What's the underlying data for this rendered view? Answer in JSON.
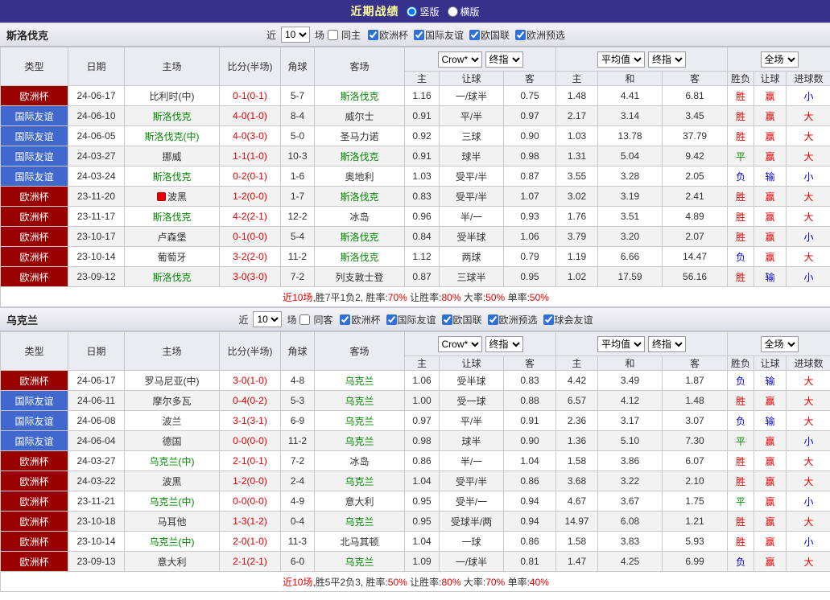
{
  "top_bar": {
    "title": "近期战绩",
    "layout_options": [
      {
        "label": "竖版",
        "selected": true
      },
      {
        "label": "横版",
        "selected": false
      }
    ]
  },
  "colors": {
    "win": "#e60000",
    "draw": "#008800",
    "loss": "#0000dd",
    "euro_bg": "#990000",
    "friendly_bg": "#4169cd",
    "team_highlight": "#008800",
    "score": "#e60000",
    "topbar_bg": "#37318c",
    "title": "#ffff99"
  },
  "table_columns": {
    "static": [
      "类型",
      "日期",
      "主场",
      "比分(半场)",
      "角球",
      "客场"
    ],
    "group1": {
      "selects": [
        "Crow*",
        "终指"
      ],
      "sub": [
        "主",
        "让球",
        "客"
      ]
    },
    "group2": {
      "selects": [
        "平均值",
        "终指"
      ],
      "sub": [
        "主",
        "和",
        "客"
      ]
    },
    "group3": {
      "selects": [
        "全场"
      ],
      "sub": [
        "胜负",
        "让球",
        "进球数"
      ]
    }
  },
  "sections": [
    {
      "team": "斯洛伐克",
      "filter": {
        "near": "近",
        "count": "10",
        "unit": "场",
        "same": "同主",
        "same_checked": false,
        "comps": [
          "欧洲杯",
          "国际友谊",
          "欧国联",
          "欧洲预选"
        ]
      },
      "rows": [
        {
          "comp": "欧洲杯",
          "ctype": "euro",
          "date": "24-06-17",
          "home": "比利时(中)",
          "hs": false,
          "icon": false,
          "score": "0-1(0-1)",
          "cor": "5-7",
          "away": "斯洛伐克",
          "as": true,
          "odds": [
            "1.16",
            "一/球半",
            "0.75",
            "1.48",
            "4.41",
            "6.81"
          ],
          "res": [
            [
              "胜",
              "red"
            ],
            [
              "赢",
              "red"
            ],
            [
              "小",
              "blue"
            ]
          ]
        },
        {
          "comp": "国际友谊",
          "ctype": "friendly",
          "date": "24-06-10",
          "home": "斯洛伐克",
          "hs": true,
          "icon": false,
          "score": "4-0(1-0)",
          "cor": "8-4",
          "away": "威尔士",
          "as": false,
          "odds": [
            "0.91",
            "平/半",
            "0.97",
            "2.17",
            "3.14",
            "3.45"
          ],
          "res": [
            [
              "胜",
              "red"
            ],
            [
              "赢",
              "red"
            ],
            [
              "大",
              "red"
            ]
          ]
        },
        {
          "comp": "国际友谊",
          "ctype": "friendly",
          "date": "24-06-05",
          "home": "斯洛伐克(中)",
          "hs": true,
          "icon": false,
          "score": "4-0(3-0)",
          "cor": "5-0",
          "away": "圣马力诺",
          "as": false,
          "odds": [
            "0.92",
            "三球",
            "0.90",
            "1.03",
            "13.78",
            "37.79"
          ],
          "res": [
            [
              "胜",
              "red"
            ],
            [
              "赢",
              "red"
            ],
            [
              "大",
              "red"
            ]
          ]
        },
        {
          "comp": "国际友谊",
          "ctype": "friendly",
          "date": "24-03-27",
          "home": "挪威",
          "hs": false,
          "icon": false,
          "score": "1-1(1-0)",
          "cor": "10-3",
          "away": "斯洛伐克",
          "as": true,
          "odds": [
            "0.91",
            "球半",
            "0.98",
            "1.31",
            "5.04",
            "9.42"
          ],
          "res": [
            [
              "平",
              "green"
            ],
            [
              "赢",
              "red"
            ],
            [
              "大",
              "red"
            ]
          ]
        },
        {
          "comp": "国际友谊",
          "ctype": "friendly",
          "date": "24-03-24",
          "home": "斯洛伐克",
          "hs": true,
          "icon": false,
          "score": "0-2(0-1)",
          "cor": "1-6",
          "away": "奥地利",
          "as": false,
          "odds": [
            "1.03",
            "受平/半",
            "0.87",
            "3.55",
            "3.28",
            "2.05"
          ],
          "res": [
            [
              "负",
              "blue"
            ],
            [
              "输",
              "blue"
            ],
            [
              "小",
              "blue"
            ]
          ]
        },
        {
          "comp": "欧洲杯",
          "ctype": "euro",
          "date": "23-11-20",
          "home": "波黑",
          "hs": false,
          "icon": true,
          "score": "1-2(0-0)",
          "cor": "1-7",
          "away": "斯洛伐克",
          "as": true,
          "odds": [
            "0.83",
            "受平/半",
            "1.07",
            "3.02",
            "3.19",
            "2.41"
          ],
          "res": [
            [
              "胜",
              "red"
            ],
            [
              "赢",
              "red"
            ],
            [
              "大",
              "red"
            ]
          ]
        },
        {
          "comp": "欧洲杯",
          "ctype": "euro",
          "date": "23-11-17",
          "home": "斯洛伐克",
          "hs": true,
          "icon": false,
          "score": "4-2(2-1)",
          "cor": "12-2",
          "away": "冰岛",
          "as": false,
          "odds": [
            "0.96",
            "半/一",
            "0.93",
            "1.76",
            "3.51",
            "4.89"
          ],
          "res": [
            [
              "胜",
              "red"
            ],
            [
              "赢",
              "red"
            ],
            [
              "大",
              "red"
            ]
          ]
        },
        {
          "comp": "欧洲杯",
          "ctype": "euro",
          "date": "23-10-17",
          "home": "卢森堡",
          "hs": false,
          "icon": false,
          "score": "0-1(0-0)",
          "cor": "5-4",
          "away": "斯洛伐克",
          "as": true,
          "odds": [
            "0.84",
            "受半球",
            "1.06",
            "3.79",
            "3.20",
            "2.07"
          ],
          "res": [
            [
              "胜",
              "red"
            ],
            [
              "赢",
              "red"
            ],
            [
              "小",
              "blue"
            ]
          ]
        },
        {
          "comp": "欧洲杯",
          "ctype": "euro",
          "date": "23-10-14",
          "home": "葡萄牙",
          "hs": false,
          "icon": false,
          "score": "3-2(2-0)",
          "cor": "11-2",
          "away": "斯洛伐克",
          "as": true,
          "odds": [
            "1.12",
            "两球",
            "0.79",
            "1.19",
            "6.66",
            "14.47"
          ],
          "res": [
            [
              "负",
              "blue"
            ],
            [
              "赢",
              "red"
            ],
            [
              "大",
              "red"
            ]
          ]
        },
        {
          "comp": "欧洲杯",
          "ctype": "euro",
          "date": "23-09-12",
          "home": "斯洛伐克",
          "hs": true,
          "icon": false,
          "score": "3-0(3-0)",
          "cor": "7-2",
          "away": "列支敦士登",
          "as": false,
          "odds": [
            "0.87",
            "三球半",
            "0.95",
            "1.02",
            "17.59",
            "56.16"
          ],
          "res": [
            [
              "胜",
              "red"
            ],
            [
              "输",
              "blue"
            ],
            [
              "小",
              "blue"
            ]
          ]
        }
      ],
      "summary": [
        [
          "近10场",
          true
        ],
        [
          ",胜7平1负2, 胜率:",
          false
        ],
        [
          "70%",
          true
        ],
        [
          " 让胜率:",
          false
        ],
        [
          "80%",
          true
        ],
        [
          " 大率:",
          false
        ],
        [
          "50%",
          true
        ],
        [
          " 单率:",
          false
        ],
        [
          "50%",
          true
        ]
      ]
    },
    {
      "team": "乌克兰",
      "filter": {
        "near": "近",
        "count": "10",
        "unit": "场",
        "same": "同客",
        "same_checked": false,
        "comps": [
          "欧洲杯",
          "国际友谊",
          "欧国联",
          "欧洲预选",
          "球会友谊"
        ]
      },
      "rows": [
        {
          "comp": "欧洲杯",
          "ctype": "euro",
          "date": "24-06-17",
          "home": "罗马尼亚(中)",
          "hs": false,
          "icon": false,
          "score": "3-0(1-0)",
          "cor": "4-8",
          "away": "乌克兰",
          "as": true,
          "odds": [
            "1.06",
            "受半球",
            "0.83",
            "4.42",
            "3.49",
            "1.87"
          ],
          "res": [
            [
              "负",
              "blue"
            ],
            [
              "输",
              "blue"
            ],
            [
              "大",
              "red"
            ]
          ]
        },
        {
          "comp": "国际友谊",
          "ctype": "friendly",
          "date": "24-06-11",
          "home": "摩尔多瓦",
          "hs": false,
          "icon": false,
          "score": "0-4(0-2)",
          "cor": "5-3",
          "away": "乌克兰",
          "as": true,
          "odds": [
            "1.00",
            "受一球",
            "0.88",
            "6.57",
            "4.12",
            "1.48"
          ],
          "res": [
            [
              "胜",
              "red"
            ],
            [
              "赢",
              "red"
            ],
            [
              "大",
              "red"
            ]
          ]
        },
        {
          "comp": "国际友谊",
          "ctype": "friendly",
          "date": "24-06-08",
          "home": "波兰",
          "hs": false,
          "icon": false,
          "score": "3-1(3-1)",
          "cor": "6-9",
          "away": "乌克兰",
          "as": true,
          "odds": [
            "0.97",
            "平/半",
            "0.91",
            "2.36",
            "3.17",
            "3.07"
          ],
          "res": [
            [
              "负",
              "blue"
            ],
            [
              "输",
              "blue"
            ],
            [
              "大",
              "red"
            ]
          ]
        },
        {
          "comp": "国际友谊",
          "ctype": "friendly",
          "date": "24-06-04",
          "home": "德国",
          "hs": false,
          "icon": false,
          "score": "0-0(0-0)",
          "cor": "11-2",
          "away": "乌克兰",
          "as": true,
          "odds": [
            "0.98",
            "球半",
            "0.90",
            "1.36",
            "5.10",
            "7.30"
          ],
          "res": [
            [
              "平",
              "green"
            ],
            [
              "赢",
              "red"
            ],
            [
              "小",
              "blue"
            ]
          ]
        },
        {
          "comp": "欧洲杯",
          "ctype": "euro",
          "date": "24-03-27",
          "home": "乌克兰(中)",
          "hs": true,
          "icon": false,
          "score": "2-1(0-1)",
          "cor": "7-2",
          "away": "冰岛",
          "as": false,
          "odds": [
            "0.86",
            "半/一",
            "1.04",
            "1.58",
            "3.86",
            "6.07"
          ],
          "res": [
            [
              "胜",
              "red"
            ],
            [
              "赢",
              "red"
            ],
            [
              "大",
              "red"
            ]
          ]
        },
        {
          "comp": "欧洲杯",
          "ctype": "euro",
          "date": "24-03-22",
          "home": "波黑",
          "hs": false,
          "icon": false,
          "score": "1-2(0-0)",
          "cor": "2-4",
          "away": "乌克兰",
          "as": true,
          "odds": [
            "1.04",
            "受平/半",
            "0.86",
            "3.68",
            "3.22",
            "2.10"
          ],
          "res": [
            [
              "胜",
              "red"
            ],
            [
              "赢",
              "red"
            ],
            [
              "大",
              "red"
            ]
          ]
        },
        {
          "comp": "欧洲杯",
          "ctype": "euro",
          "date": "23-11-21",
          "home": "乌克兰(中)",
          "hs": true,
          "icon": false,
          "score": "0-0(0-0)",
          "cor": "4-9",
          "away": "意大利",
          "as": false,
          "odds": [
            "0.95",
            "受半/一",
            "0.94",
            "4.67",
            "3.67",
            "1.75"
          ],
          "res": [
            [
              "平",
              "green"
            ],
            [
              "赢",
              "red"
            ],
            [
              "小",
              "blue"
            ]
          ]
        },
        {
          "comp": "欧洲杯",
          "ctype": "euro",
          "date": "23-10-18",
          "home": "马耳他",
          "hs": false,
          "icon": false,
          "score": "1-3(1-2)",
          "cor": "0-4",
          "away": "乌克兰",
          "as": true,
          "odds": [
            "0.95",
            "受球半/两",
            "0.94",
            "14.97",
            "6.08",
            "1.21"
          ],
          "res": [
            [
              "胜",
              "red"
            ],
            [
              "赢",
              "red"
            ],
            [
              "大",
              "red"
            ]
          ]
        },
        {
          "comp": "欧洲杯",
          "ctype": "euro",
          "date": "23-10-14",
          "home": "乌克兰(中)",
          "hs": true,
          "icon": false,
          "score": "2-0(1-0)",
          "cor": "11-3",
          "away": "北马其顿",
          "as": false,
          "odds": [
            "1.04",
            "一球",
            "0.86",
            "1.58",
            "3.83",
            "5.93"
          ],
          "res": [
            [
              "胜",
              "red"
            ],
            [
              "赢",
              "red"
            ],
            [
              "小",
              "blue"
            ]
          ]
        },
        {
          "comp": "欧洲杯",
          "ctype": "euro",
          "date": "23-09-13",
          "home": "意大利",
          "hs": false,
          "icon": false,
          "score": "2-1(2-1)",
          "cor": "6-0",
          "away": "乌克兰",
          "as": true,
          "odds": [
            "1.09",
            "一/球半",
            "0.81",
            "1.47",
            "4.25",
            "6.99"
          ],
          "res": [
            [
              "负",
              "blue"
            ],
            [
              "赢",
              "red"
            ],
            [
              "大",
              "red"
            ]
          ]
        }
      ],
      "summary": [
        [
          "近10场",
          true
        ],
        [
          ",胜5平2负3, 胜率:",
          false
        ],
        [
          "50%",
          true
        ],
        [
          " 让胜率:",
          false
        ],
        [
          "80%",
          true
        ],
        [
          " 大率:",
          false
        ],
        [
          "70%",
          true
        ],
        [
          " 单率:",
          false
        ],
        [
          "40%",
          true
        ]
      ]
    }
  ]
}
